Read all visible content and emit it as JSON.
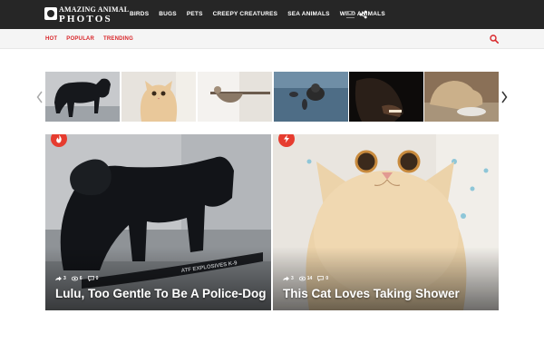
{
  "header": {
    "logo_line1": "AMAZING ANIMAL",
    "logo_line2": "PHOTOS",
    "nav": [
      "BIRDS",
      "BUGS",
      "PETS",
      "CREEPY CREATURES",
      "SEA ANIMALS",
      "WILD ANIMALS"
    ],
    "menu_icon": "hamburger-icon",
    "share_icon": "share-icon"
  },
  "subnav": {
    "tabs": [
      "HOT",
      "POPULAR",
      "TRENDING"
    ],
    "search_icon": "search-icon",
    "accent_color": "#d9262a"
  },
  "carousel": {
    "prev_icon": "chevron-left-icon",
    "next_icon": "chevron-right-icon",
    "thumbnails": [
      "black-dog",
      "cat",
      "cat-shelf",
      "sea-otter",
      "chimpanzee",
      "lion-eating"
    ]
  },
  "cards": [
    {
      "badge_icon": "flame-icon",
      "shares": "3",
      "views": "6",
      "comments": "0",
      "title": "Lulu, Too Gentle To Be A Police-Dog"
    },
    {
      "badge_icon": "lightning-icon",
      "shares": "3",
      "views": "14",
      "comments": "0",
      "title": "This Cat Loves Taking Shower"
    }
  ],
  "badge_color": "#e63c2f"
}
